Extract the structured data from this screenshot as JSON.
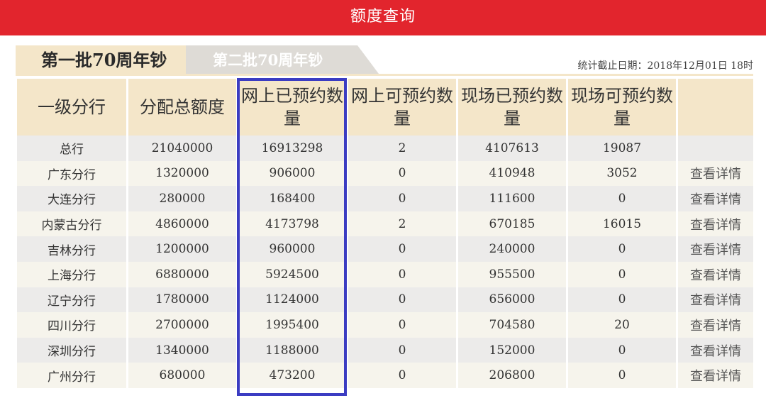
{
  "header": {
    "title": "额度查询"
  },
  "tabs": [
    {
      "label": "第一批70周年钞"
    },
    {
      "label": "第二批70周年钞"
    }
  ],
  "stats_date": "统计截止日期：2018年12月01日 18时",
  "table": {
    "headers": [
      "一级分行",
      "分配总额度",
      "网上已预约数量",
      "网上可预约数量",
      "现场已预约数量",
      "现场可预约数量",
      ""
    ],
    "detail_label": "查看详情",
    "rows": [
      {
        "branch": "总行",
        "total": "21040000",
        "online_booked": "16913298",
        "online_available": "2",
        "onsite_booked": "4107613",
        "onsite_available": "19087",
        "action": ""
      },
      {
        "branch": "广东分行",
        "total": "1320000",
        "online_booked": "906000",
        "online_available": "0",
        "onsite_booked": "410948",
        "onsite_available": "3052",
        "action": "查看详情"
      },
      {
        "branch": "大连分行",
        "total": "280000",
        "online_booked": "168400",
        "online_available": "0",
        "onsite_booked": "111600",
        "onsite_available": "0",
        "action": "查看详情"
      },
      {
        "branch": "内蒙古分行",
        "total": "4860000",
        "online_booked": "4173798",
        "online_available": "2",
        "onsite_booked": "670185",
        "onsite_available": "16015",
        "action": "查看详情"
      },
      {
        "branch": "吉林分行",
        "total": "1200000",
        "online_booked": "960000",
        "online_available": "0",
        "onsite_booked": "240000",
        "onsite_available": "0",
        "action": "查看详情"
      },
      {
        "branch": "上海分行",
        "total": "6880000",
        "online_booked": "5924500",
        "online_available": "0",
        "onsite_booked": "955500",
        "onsite_available": "0",
        "action": "查看详情"
      },
      {
        "branch": "辽宁分行",
        "total": "1780000",
        "online_booked": "1124000",
        "online_available": "0",
        "onsite_booked": "656000",
        "onsite_available": "0",
        "action": "查看详情"
      },
      {
        "branch": "四川分行",
        "total": "2700000",
        "online_booked": "1995400",
        "online_available": "0",
        "onsite_booked": "704580",
        "onsite_available": "20",
        "action": "查看详情"
      },
      {
        "branch": "深圳分行",
        "total": "1340000",
        "online_booked": "1188000",
        "online_available": "0",
        "onsite_booked": "152000",
        "onsite_available": "0",
        "action": "查看详情"
      },
      {
        "branch": "广州分行",
        "total": "680000",
        "online_booked": "473200",
        "online_available": "0",
        "onsite_booked": "206800",
        "onsite_available": "0",
        "action": "查看详情"
      }
    ]
  },
  "colors": {
    "header_red": "#e2252d",
    "tab_active": "#f4e6c9",
    "tab_inactive": "#dedbd6",
    "highlight_border": "#3b3cc2"
  }
}
